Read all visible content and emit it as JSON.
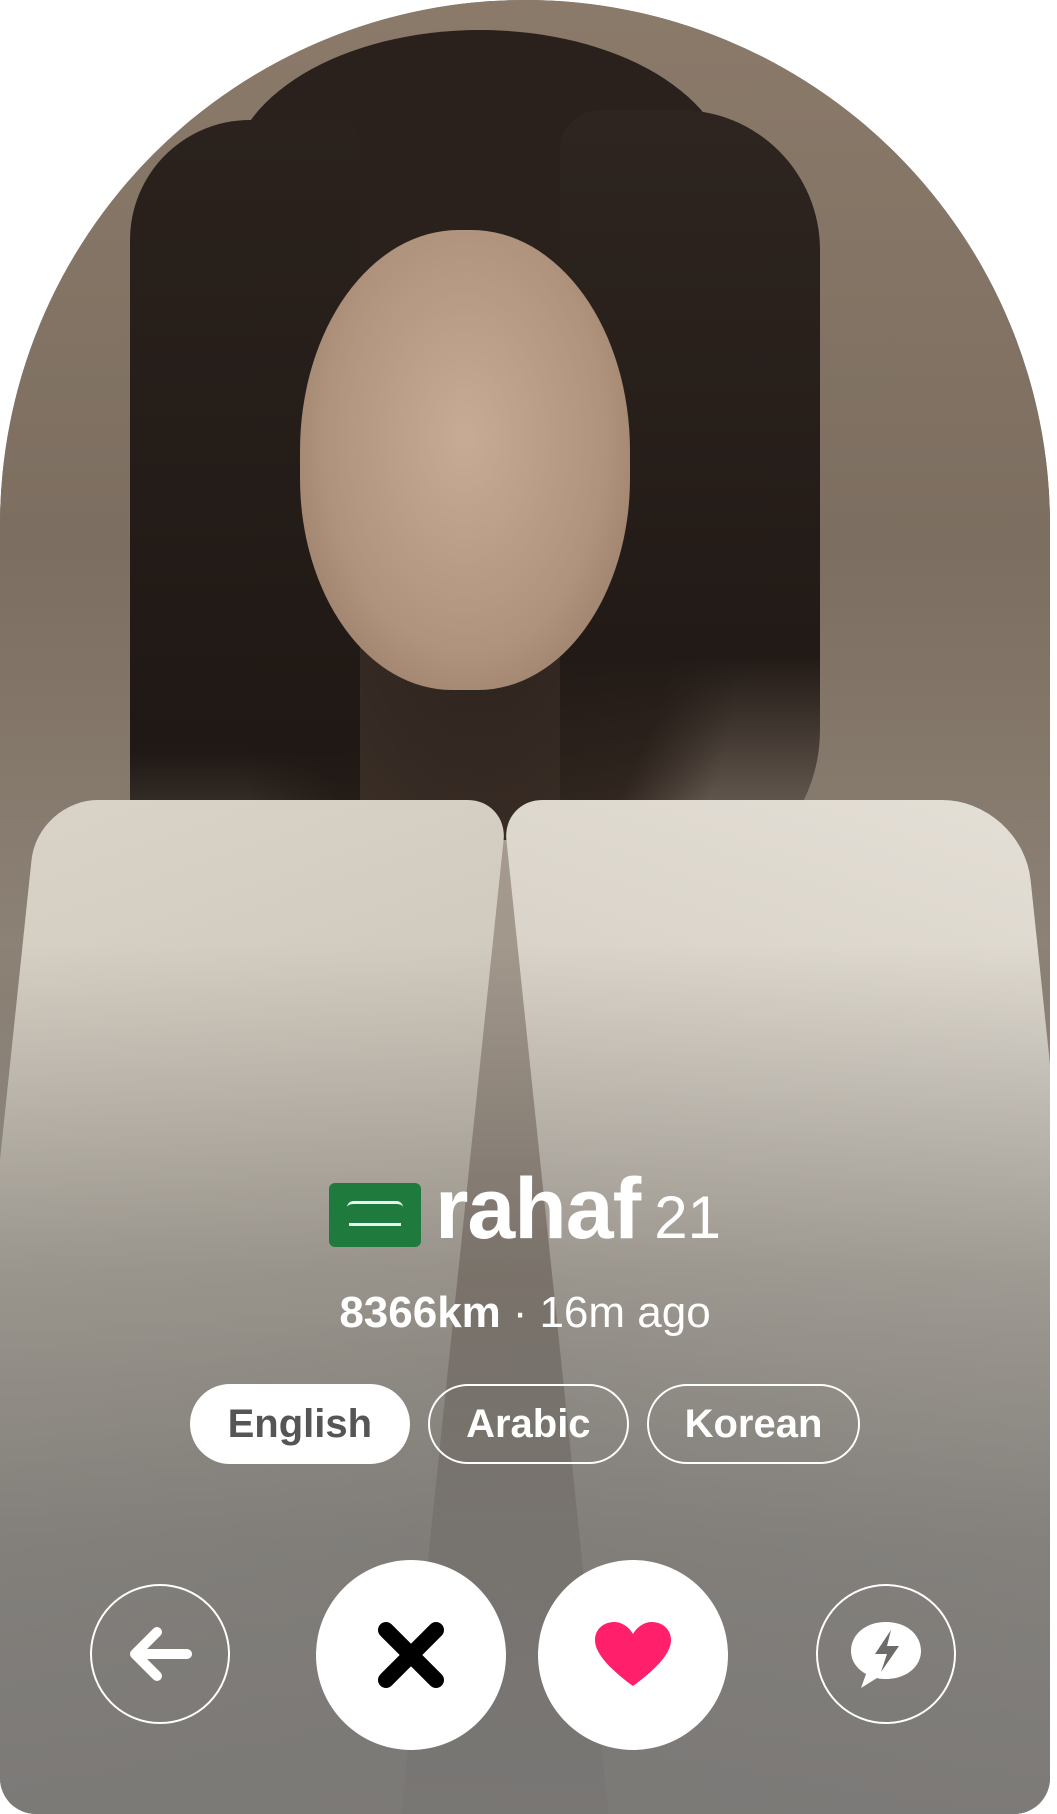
{
  "profile": {
    "country_flag": "saudi-arabia-flag",
    "name": "rahaf",
    "age": "21",
    "distance": "8366km",
    "separator": "·",
    "last_active": "16m ago",
    "languages": [
      {
        "label": "English",
        "selected": true
      },
      {
        "label": "Arabic",
        "selected": false
      },
      {
        "label": "Korean",
        "selected": false
      }
    ]
  },
  "actions": {
    "back_icon": "arrow-left-icon",
    "nope_icon": "x-icon",
    "like_icon": "heart-icon",
    "boost_icon": "lightning-chat-icon"
  },
  "colors": {
    "like": "#ff1f6b",
    "nope": "#000000",
    "flag_green": "#1f7a3d",
    "chip_active_text": "#555555"
  }
}
